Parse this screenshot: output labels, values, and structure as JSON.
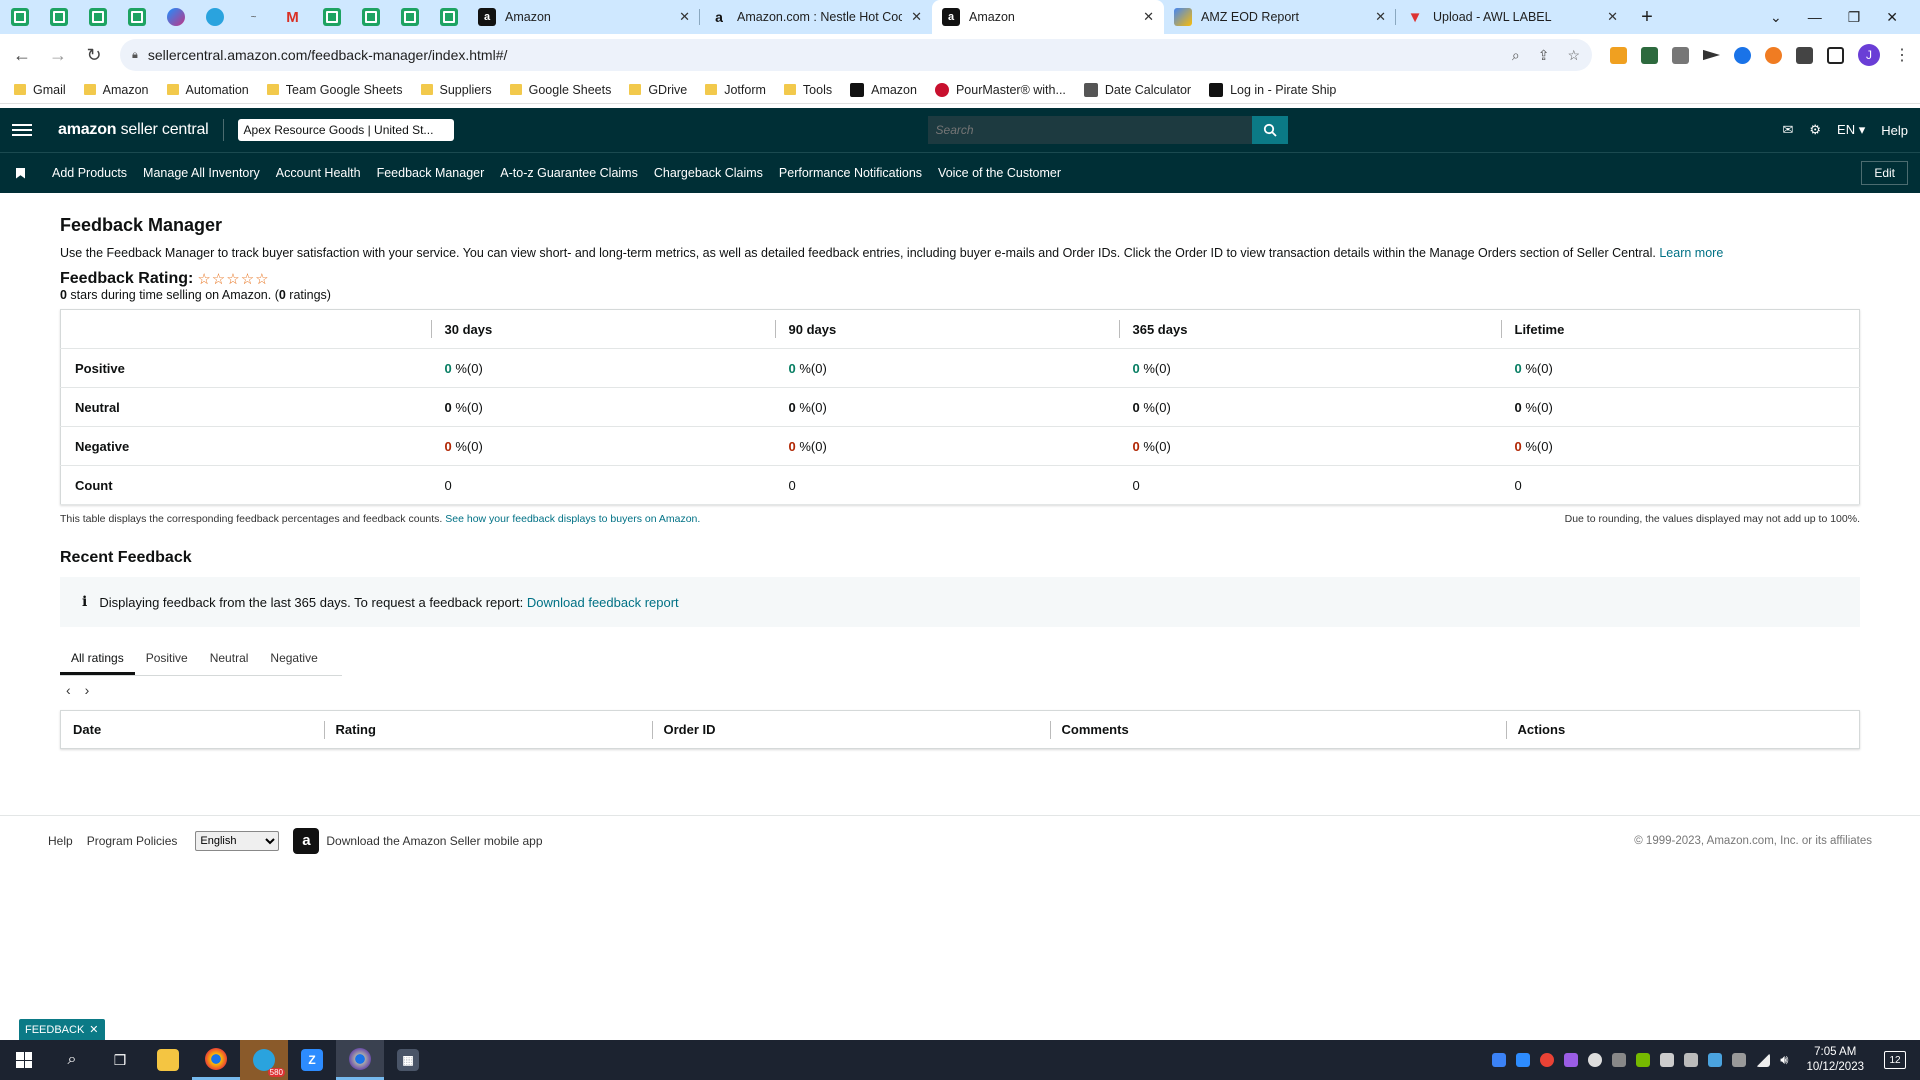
{
  "browser": {
    "tabs": [
      {
        "title": "Amazon",
        "active": false
      },
      {
        "title": "Amazon.com : Nestle Hot Coco",
        "active": false
      },
      {
        "title": "Amazon",
        "active": true
      },
      {
        "title": "AMZ EOD Report",
        "active": false
      },
      {
        "title": "Upload - AWL LABEL",
        "active": false
      }
    ],
    "url": "sellercentral.amazon.com/feedback-manager/index.html#/",
    "profile_initial": "J",
    "bookmarks": [
      {
        "label": "Gmail",
        "icon": "folder-icon"
      },
      {
        "label": "Amazon",
        "icon": "folder-icon"
      },
      {
        "label": "Automation",
        "icon": "folder-icon"
      },
      {
        "label": "Team Google Sheets",
        "icon": "folder-icon"
      },
      {
        "label": "Suppliers",
        "icon": "folder-icon"
      },
      {
        "label": "Google Sheets",
        "icon": "folder-icon"
      },
      {
        "label": "GDrive",
        "icon": "folder-icon"
      },
      {
        "label": "Jotform",
        "icon": "folder-icon"
      },
      {
        "label": "Tools",
        "icon": "folder-icon"
      },
      {
        "label": "Amazon",
        "icon": "amazon-icon"
      },
      {
        "label": "PourMaster® with...",
        "icon": "pourmaster-icon"
      },
      {
        "label": "Date Calculator",
        "icon": "calculator-icon"
      },
      {
        "label": "Log in - Pirate Ship",
        "icon": "pirate-ship-icon"
      }
    ]
  },
  "header": {
    "logo_bold": "amazon",
    "logo_rest": " seller central",
    "account": "Apex Resource Goods | United St...",
    "search_placeholder": "Search",
    "language": "EN",
    "help": "Help",
    "nav": [
      "Add Products",
      "Manage All Inventory",
      "Account Health",
      "Feedback Manager",
      "A-to-z Guarantee Claims",
      "Chargeback Claims",
      "Performance Notifications",
      "Voice of the Customer"
    ],
    "edit": "Edit"
  },
  "page": {
    "title": "Feedback Manager",
    "description": "Use the Feedback Manager to track buyer satisfaction with your service. You can view short- and long-term metrics, as well as detailed feedback entries, including buyer e-mails and Order IDs. Click the Order ID to view transaction details within the Manage Orders section of Seller Central.",
    "learn_more": "Learn more",
    "rating_label": "Feedback Rating:",
    "stars": "☆☆☆☆☆",
    "stars_count": "0",
    "stars_text": " stars during time selling on Amazon. (",
    "ratings_count": "0",
    "ratings_text": " ratings)"
  },
  "metrics": {
    "columns": [
      "30 days",
      "90 days",
      "365 days",
      "Lifetime"
    ],
    "rows": [
      {
        "label": "Positive",
        "kind": "pos",
        "cells": [
          {
            "num": "0",
            "rest": " %(0)"
          },
          {
            "num": "0",
            "rest": " %(0)"
          },
          {
            "num": "0",
            "rest": " %(0)"
          },
          {
            "num": "0",
            "rest": " %(0)"
          }
        ]
      },
      {
        "label": "Neutral",
        "kind": "neu",
        "cells": [
          {
            "num": "0",
            "rest": " %(0)"
          },
          {
            "num": "0",
            "rest": " %(0)"
          },
          {
            "num": "0",
            "rest": " %(0)"
          },
          {
            "num": "0",
            "rest": " %(0)"
          }
        ]
      },
      {
        "label": "Negative",
        "kind": "neg",
        "cells": [
          {
            "num": "0",
            "rest": " %(0)"
          },
          {
            "num": "0",
            "rest": " %(0)"
          },
          {
            "num": "0",
            "rest": " %(0)"
          },
          {
            "num": "0",
            "rest": " %(0)"
          }
        ]
      },
      {
        "label": "Count",
        "kind": "count",
        "cells": [
          {
            "num": "",
            "rest": "0"
          },
          {
            "num": "",
            "rest": "0"
          },
          {
            "num": "",
            "rest": "0"
          },
          {
            "num": "",
            "rest": "0"
          }
        ]
      }
    ],
    "note_left": "This table displays the corresponding feedback percentages and feedback counts.",
    "note_link": "See how your feedback displays to buyers on Amazon.",
    "note_right": "Due to rounding, the values displayed may not add up to 100%."
  },
  "recent": {
    "title": "Recent Feedback",
    "info_text": "Displaying feedback from the last 365 days. To request a feedback report:",
    "info_link": "Download feedback report",
    "tabs": [
      "All ratings",
      "Positive",
      "Neutral",
      "Negative"
    ],
    "active_tab": 0,
    "columns": [
      "Date",
      "Rating",
      "Order ID",
      "Comments",
      "Actions"
    ]
  },
  "footer": {
    "help": "Help",
    "policies": "Program Policies",
    "language": "English",
    "app_text": "Download the Amazon Seller mobile app",
    "copyright": "© 1999-2023, Amazon.com, Inc. or its affiliates"
  },
  "feedback_tab": "FEEDBACK",
  "taskbar": {
    "telegram_badge": "580",
    "time": "7:05 AM",
    "date": "10/12/2023",
    "notifications": "12"
  },
  "colors": {
    "header_bg": "#002f36",
    "accent": "#007185",
    "positive": "#067d62",
    "negative": "#b12704"
  }
}
